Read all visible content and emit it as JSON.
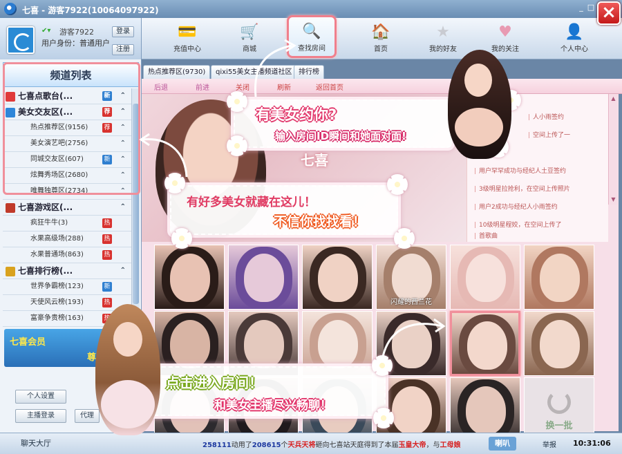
{
  "window": {
    "title": "七喜 - 游客7922(10064097922)",
    "min_label": "_",
    "max_label": "□",
    "close_label": "×"
  },
  "user": {
    "status_icon": "✔▾",
    "name": "游客7922",
    "identity": "用户身份：普通用户",
    "login_label": "登录",
    "register_label": "注册"
  },
  "nav": {
    "items": [
      {
        "label": "充值中心",
        "icon": "card-icon",
        "glyph": "💳"
      },
      {
        "label": "商城",
        "icon": "cart-icon",
        "glyph": "🛒"
      },
      {
        "label": "查找房间",
        "icon": "search-icon",
        "glyph": "🔍"
      },
      {
        "label": "首页",
        "icon": "home-icon",
        "glyph": "🏠"
      },
      {
        "label": "我的好友",
        "icon": "star-icon",
        "glyph": "★"
      },
      {
        "label": "我的关注",
        "icon": "heart-icon",
        "glyph": "♥"
      },
      {
        "label": "个人中心",
        "icon": "user-icon",
        "glyph": "👤"
      }
    ]
  },
  "sidebar": {
    "title": "频道列表",
    "rows": [
      {
        "kind": "group",
        "label": "七喜点歌台(...",
        "badge": "新",
        "badge_type": "new",
        "icon_color": "#e03a3a"
      },
      {
        "kind": "group",
        "label": "美女交友区(...",
        "badge": "荐",
        "badge_type": "hot",
        "icon_color": "#2e86d9"
      },
      {
        "kind": "sub",
        "label": "热点推荐区(9156)",
        "badge": "荐",
        "badge_type": "hot"
      },
      {
        "kind": "sub",
        "label": "美女演艺吧(2756)",
        "badge": "",
        "badge_type": ""
      },
      {
        "kind": "sub",
        "label": "同城交友区(607)",
        "badge": "新",
        "badge_type": "new"
      },
      {
        "kind": "sub",
        "label": "炫舞秀场区(2680)",
        "badge": "",
        "badge_type": ""
      },
      {
        "kind": "sub",
        "label": "唯舞独尊区(2734)",
        "badge": "",
        "badge_type": ""
      },
      {
        "kind": "group",
        "label": "七喜游戏区(...",
        "badge": "",
        "badge_type": "",
        "icon_color": "#c03a2a"
      },
      {
        "kind": "sub",
        "label": "疯狂牛牛(3)",
        "badge": "热",
        "badge_type": "hot"
      },
      {
        "kind": "sub",
        "label": "水果高级场(288)",
        "badge": "热",
        "badge_type": "hot"
      },
      {
        "kind": "sub",
        "label": "水果普通场(863)",
        "badge": "热",
        "badge_type": "hot"
      },
      {
        "kind": "group",
        "label": "七喜排行榜(...",
        "badge": "",
        "badge_type": "",
        "icon_color": "#d9a21e"
      },
      {
        "kind": "sub",
        "label": "世界争霸榜(123)",
        "badge": "新",
        "badge_type": "new"
      },
      {
        "kind": "sub",
        "label": "天使风云榜(193)",
        "badge": "热",
        "badge_type": "hot"
      },
      {
        "kind": "sub",
        "label": "富豪争贵榜(163)",
        "badge": "热",
        "badge_type": "hot"
      }
    ],
    "chev": "⌃",
    "vip_text_1": "七喜会员",
    "vip_text_2": "尊享",
    "personal_settings": "个人设置",
    "host_login": "主播登录",
    "agent_label": "代理",
    "hall_label": "聊天大厅"
  },
  "tabs": [
    {
      "label": "热点推荐区(9730)"
    },
    {
      "label": "qixi55美女主播频道社区"
    },
    {
      "label": "排行榜"
    }
  ],
  "browser": {
    "back": "后退",
    "forward": "前进",
    "close": "关闭",
    "refresh": "刷新",
    "home": "返回首页"
  },
  "hero": {
    "emblem": "七喜"
  },
  "news": [
    "人小雨签约",
    "空间上传了一",
    "用户罕罕成功与经纪人土豆签约",
    "3级明星拉抢利，在空间上传照片",
    "用户2成功与经纪人小雨签约",
    "10级明星程姣，在空间上传了",
    "首歌曲"
  ],
  "grid": {
    "caption_1": "闪耀的西兰花",
    "refresh_label": "换一批"
  },
  "promos": {
    "p1_line1": "有美女约你?",
    "p1_line2": "输入房间ID瞬间和她面对面!",
    "p2_line1": "有好多美女就藏在这儿！",
    "p2_line2": "不信你找找看！",
    "p3_line1": "点击进入房间！",
    "p3_line2": "和美女主播尽兴畅聊！"
  },
  "status": {
    "num1": "258111",
    "t1": "动用了",
    "num2": "208615",
    "t2": "个",
    "gift": "天兵天将",
    "t3": "砸向七喜站天庭得到了本届",
    "title1": "玉皇大帝",
    "t4": "，与",
    "title2": "工母娘",
    "speaker": "喇叭",
    "report": "举报",
    "clock": "10:31:06"
  },
  "colors": {
    "accent_pink": "#f08f9b",
    "brand_blue": "#2e86d9"
  }
}
